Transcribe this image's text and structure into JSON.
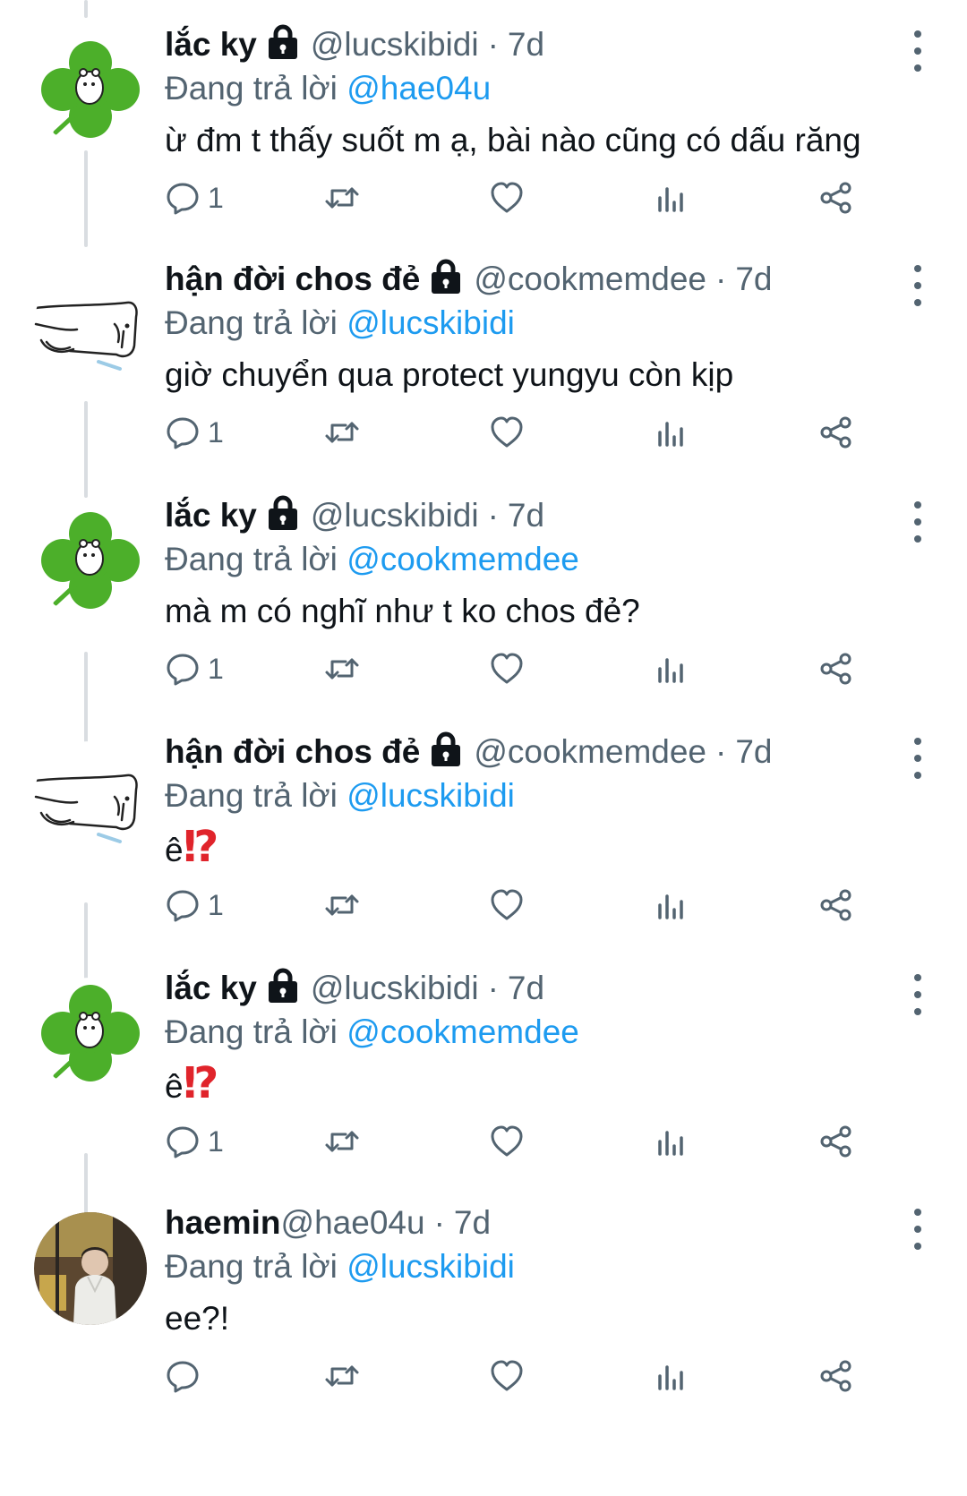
{
  "tweets": [
    {
      "name": "lắc ky",
      "handle": "@lucskibidi",
      "dot": "·",
      "time": "7d",
      "reply_prefix": "Đang trả lời",
      "reply_to": "@hae04u",
      "text": "ừ đm t thấy suốt m ạ, bài nào cũng có dấu răng",
      "emph": "",
      "reply_count": "1",
      "avatar": "clover-avatar",
      "locked": true
    },
    {
      "name": "hận đời chos đẻ",
      "handle": "@cookmemdee",
      "dot": "·",
      "time": "7d",
      "reply_prefix": "Đang trả lời",
      "reply_to": "@lucskibidi",
      "text": "giờ chuyển qua protect yungyu còn kịp",
      "emph": "",
      "reply_count": "1",
      "avatar": "sketch-avatar",
      "locked": true
    },
    {
      "name": "lắc ky",
      "handle": "@lucskibidi",
      "dot": "·",
      "time": "7d",
      "reply_prefix": "Đang trả lời",
      "reply_to": "@cookmemdee",
      "text": "mà m có nghĩ như t ko chos đẻ?",
      "emph": "",
      "reply_count": "1",
      "avatar": "clover-avatar",
      "locked": true
    },
    {
      "name": "hận đời chos đẻ",
      "handle": "@cookmemdee",
      "dot": "·",
      "time": "7d",
      "reply_prefix": "Đang trả lời",
      "reply_to": "@lucskibidi",
      "text": "ê",
      "emph": "⁉",
      "reply_count": "1",
      "avatar": "sketch-avatar",
      "locked": true
    },
    {
      "name": "lắc ky",
      "handle": "@lucskibidi",
      "dot": "·",
      "time": "7d",
      "reply_prefix": "Đang trả lời",
      "reply_to": "@cookmemdee",
      "text": "ê",
      "emph": "⁉",
      "reply_count": "1",
      "avatar": "clover-avatar",
      "locked": true
    },
    {
      "name": "haemin",
      "handle": "@hae04u",
      "dot": "·",
      "time": "7d",
      "reply_prefix": "Đang trả lời",
      "reply_to": "@lucskibidi",
      "text": "ee?!",
      "emph": "",
      "reply_count": "",
      "avatar": "photo-avatar",
      "locked": false
    }
  ],
  "icons": {
    "reply": "reply-icon",
    "retweet": "retweet-icon",
    "like": "heart-icon",
    "views": "views-icon",
    "share": "share-icon",
    "more": "more-icon",
    "lock": "lock-icon"
  },
  "colors": {
    "accent": "#1d9bf0",
    "muted": "#536471",
    "text": "#0f1419",
    "emph": "#e0242b",
    "clover": "#4caf2a"
  }
}
